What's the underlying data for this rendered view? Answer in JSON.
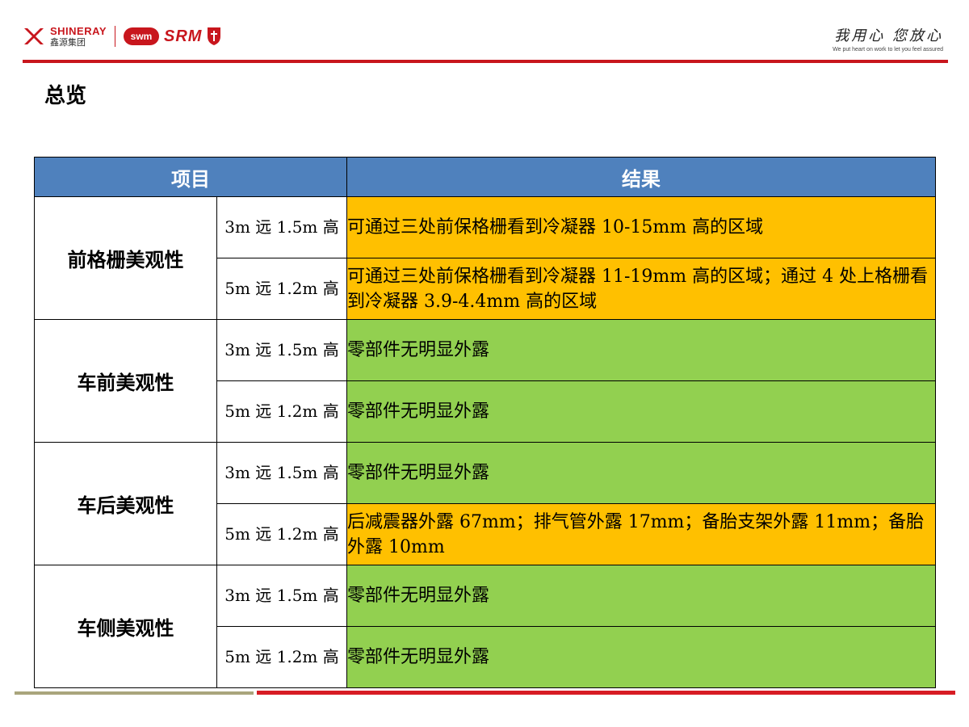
{
  "header": {
    "brand_en": "SHINERAY",
    "brand_cn": "鑫源集团",
    "swm": "swm",
    "srm": "SRM",
    "slogan_cn": "我用心 您放心",
    "slogan_en": "We put heart on work to let you feel assured",
    "colors": {
      "brand_red": "#c8161d"
    }
  },
  "page": {
    "title": "总览"
  },
  "table": {
    "headers": {
      "item": "项目",
      "result": "结果"
    },
    "colors": {
      "header": "#4f81bd",
      "orange": "#ffc000",
      "green": "#92d050"
    },
    "groups": [
      {
        "category": "前格栅美观性",
        "rows": [
          {
            "distance": "3m 远 1.5m 高",
            "result": "可通过三处前保格栅看到冷凝器 10-15mm 高的区域",
            "status": "orange"
          },
          {
            "distance": "5m 远 1.2m 高",
            "result": "可通过三处前保格栅看到冷凝器 11-19mm 高的区域；通过 4 处上格栅看到冷凝器 3.9-4.4mm 高的区域",
            "status": "orange"
          }
        ]
      },
      {
        "category": "车前美观性",
        "rows": [
          {
            "distance": "3m 远 1.5m 高",
            "result": "零部件无明显外露",
            "status": "green"
          },
          {
            "distance": "5m 远 1.2m 高",
            "result": "零部件无明显外露",
            "status": "green"
          }
        ]
      },
      {
        "category": "车后美观性",
        "rows": [
          {
            "distance": "3m 远 1.5m 高",
            "result": "零部件无明显外露",
            "status": "green"
          },
          {
            "distance": "5m 远 1.2m 高",
            "result": "后减震器外露 67mm；排气管外露 17mm；备胎支架外露 11mm；备胎外露 10mm",
            "status": "orange"
          }
        ]
      },
      {
        "category": "车侧美观性",
        "rows": [
          {
            "distance": "3m 远 1.5m 高",
            "result": "零部件无明显外露",
            "status": "green"
          },
          {
            "distance": "5m 远 1.2m 高",
            "result": "零部件无明显外露",
            "status": "green"
          }
        ]
      }
    ]
  }
}
